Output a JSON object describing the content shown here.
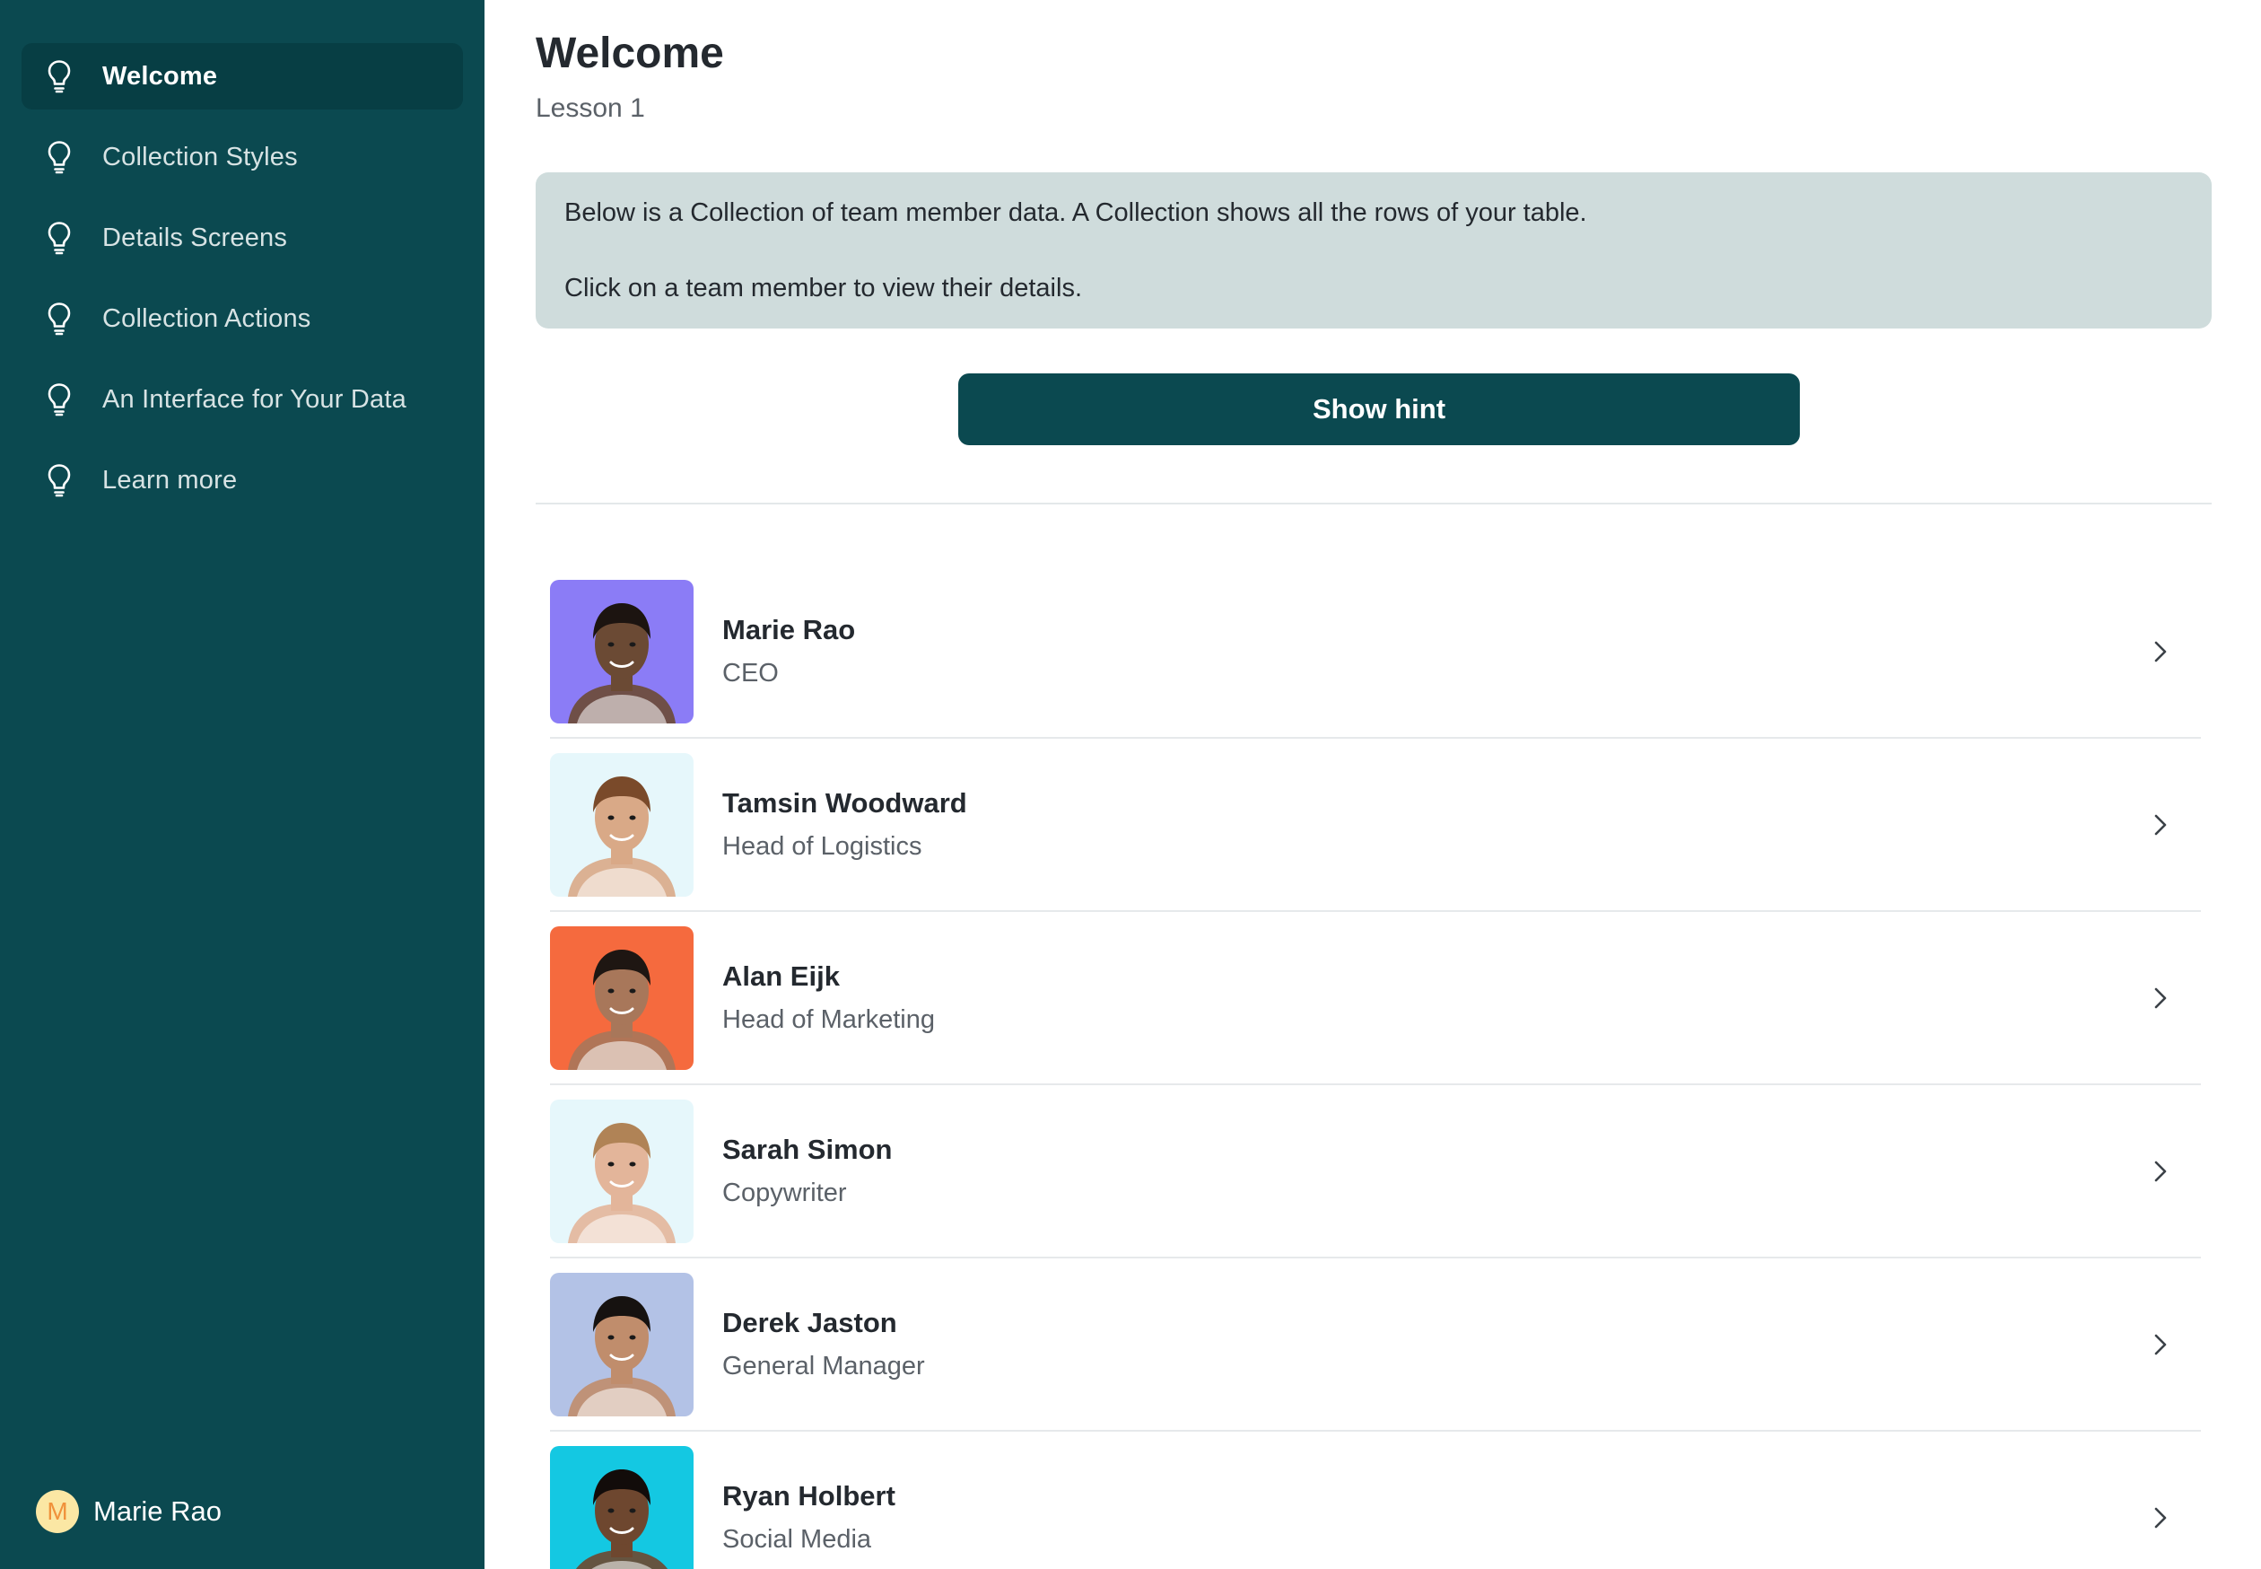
{
  "sidebar": {
    "items": [
      {
        "label": "Welcome",
        "icon": "lightbulb-icon",
        "active": true
      },
      {
        "label": "Collection Styles",
        "icon": "lightbulb-icon"
      },
      {
        "label": "Details Screens",
        "icon": "lightbulb-icon"
      },
      {
        "label": "Collection Actions",
        "icon": "lightbulb-icon"
      },
      {
        "label": "An Interface for Your Data",
        "icon": "lightbulb-icon"
      },
      {
        "label": "Learn more",
        "icon": "lightbulb-icon"
      }
    ],
    "user": {
      "initial": "M",
      "name": "Marie Rao"
    }
  },
  "main": {
    "title": "Welcome",
    "subtitle": "Lesson 1",
    "info": {
      "line1": "Below is a Collection of team member data. A Collection shows all the rows of your table.",
      "line2": "Click on a team member to view their details."
    },
    "hint_button": "Show hint",
    "members": [
      {
        "name": "Marie Rao",
        "role": "CEO",
        "bg": "#8b7cf6",
        "skin": "#6b4a34",
        "hair": "#1c1410"
      },
      {
        "name": "Tamsin Woodward",
        "role": "Head of Logistics",
        "bg": "#e6f7fb",
        "skin": "#d9a987",
        "hair": "#7a4a2a"
      },
      {
        "name": "Alan Eijk",
        "role": "Head of Marketing",
        "bg": "#f56a3e",
        "skin": "#a8775a",
        "hair": "#1e1612"
      },
      {
        "name": "Sarah Simon",
        "role": "Copywriter",
        "bg": "#e6f7fb",
        "skin": "#e3b59a",
        "hair": "#b08356"
      },
      {
        "name": "Derek Jaston",
        "role": "General Manager",
        "bg": "#b3c2e6",
        "skin": "#c08d6c",
        "hair": "#161210"
      },
      {
        "name": "Ryan Holbert",
        "role": "Social Media",
        "bg": "#14c8e2",
        "skin": "#6e472f",
        "hair": "#120c0a"
      }
    ]
  },
  "colors": {
    "sidebar": "#0b4950",
    "accent": "#0b4950",
    "info_bg": "#cfdcdc"
  }
}
